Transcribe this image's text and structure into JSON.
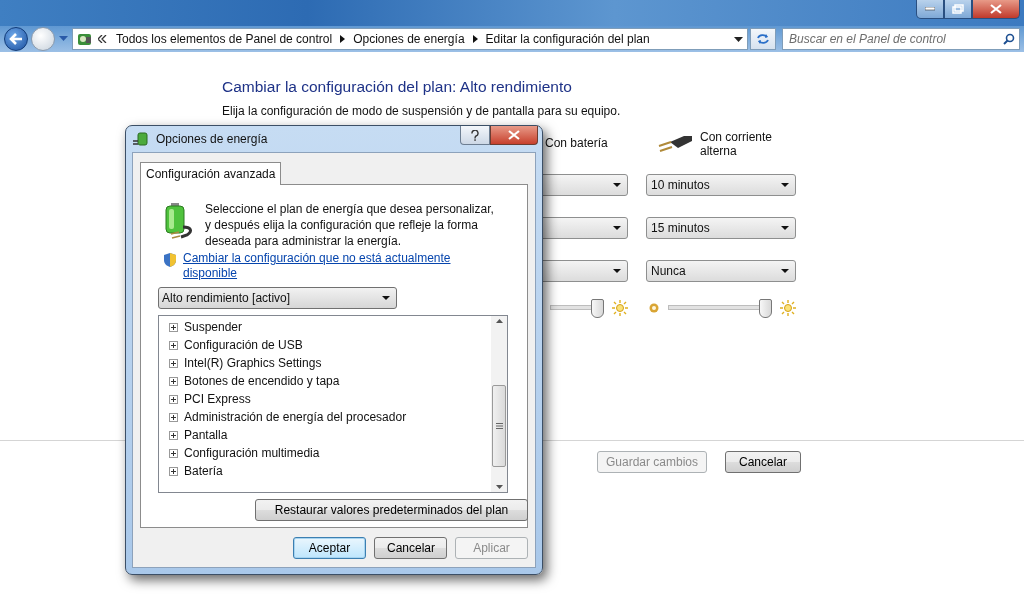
{
  "address_bar": {
    "breadcrumbs": [
      "Todos los elementos de Panel de control",
      "Opciones de energía",
      "Editar la configuración del plan"
    ]
  },
  "search": {
    "placeholder": "Buscar en el Panel de control"
  },
  "page": {
    "title": "Cambiar la configuración del plan: Alto rendimiento",
    "subtitle": "Elija la configuración de modo de suspensión y de pantalla para su equipo.",
    "columns": [
      {
        "kind": "battery",
        "label": "Con batería"
      },
      {
        "kind": "ac",
        "label": "Con corriente alterna"
      }
    ],
    "settings": [
      {
        "kind": "dropdown",
        "ac_value": "10 minutos"
      },
      {
        "kind": "dropdown",
        "ac_value": "15 minutos"
      },
      {
        "kind": "dropdown",
        "ac_value": "Nunca"
      },
      {
        "kind": "slider",
        "battery": {
          "level": 1
        },
        "ac": {
          "level": 1
        }
      }
    ],
    "buttons": [
      {
        "label": "Guardar cambios",
        "disabled": true
      },
      {
        "label": "Cancelar",
        "disabled": false
      }
    ]
  },
  "dialog": {
    "title": "Opciones de energía",
    "tabs": [
      {
        "label": "Configuración avanzada",
        "selected": true
      }
    ],
    "description": "Seleccione el plan de energía que desea personalizar, y después elija la configuración que refleje la forma deseada para administrar la energía.",
    "link": "Cambiar la configuración que no está actualmente disponible",
    "plan": "Alto rendimiento [activo]",
    "tree": [
      {
        "label": "Suspender",
        "expanded": false
      },
      {
        "label": "Configuración de USB",
        "expanded": false
      },
      {
        "label": "Intel(R) Graphics Settings",
        "expanded": false
      },
      {
        "label": "Botones de encendido y tapa",
        "expanded": false
      },
      {
        "label": "PCI Express",
        "expanded": false
      },
      {
        "label": "Administración de energía del procesador",
        "expanded": false
      },
      {
        "label": "Pantalla",
        "expanded": false
      },
      {
        "label": "Configuración multimedia",
        "expanded": false
      },
      {
        "label": "Batería",
        "expanded": false
      }
    ],
    "restore_button": "Restaurar valores predeterminados del plan",
    "buttons": [
      {
        "label": "Aceptar",
        "default": true,
        "disabled": false
      },
      {
        "label": "Cancelar",
        "default": false,
        "disabled": false
      },
      {
        "label": "Aplicar",
        "default": false,
        "disabled": true
      }
    ]
  }
}
